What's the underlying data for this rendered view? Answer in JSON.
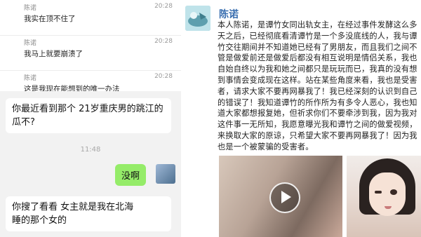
{
  "chat_list": {
    "items": [
      {
        "name": "陈诺",
        "time": "20:28",
        "text": "我实在顶不住了"
      },
      {
        "name": "陈诺",
        "time": "20:28",
        "text": "我马上就要崩溃了"
      },
      {
        "name": "陈诺",
        "time": "20:28",
        "text": "这是我现在能想到的唯一办法"
      }
    ]
  },
  "conversation": {
    "msg1": "你最近看到那个 21岁重庆男的跳江的瓜不?",
    "timestamp": "11:48",
    "reply": "没啊",
    "msg2_line1": "你搜了看看  女主就是我在北海",
    "msg2_line2": "睡的那个女的"
  },
  "post": {
    "author": "陈诺",
    "body": "本人陈诺，是谭竹女同出轨女主，在经过事件发酵这么多天之后，已经彻底看清谭竹是一个多没底线的人，我与谭竹交往期间并不知道她已经有了男朋友，而且我们之间不管是做爱前还是做爱后都没有相互说明是情侣关系，我也自始自终以为我和她之间都只是玩玩而已，我真的没有想到事情会变成现在这样。站在某些角度来看，我也是受害者，请求大家不要再网暴我了！我已经深刻的认识到自己的错误了！我知道谭竹的所作所为有多令人恶心，我也知道大家都想报复她，但祈求你们不要牵涉到我，因为我对这件事一无所知，我愿意曝光我和谭竹之间的做爱视频，来换取大家的原谅，只希望大家不要再网暴我了！因为我也是一个被蒙骗的受害者。"
  }
}
